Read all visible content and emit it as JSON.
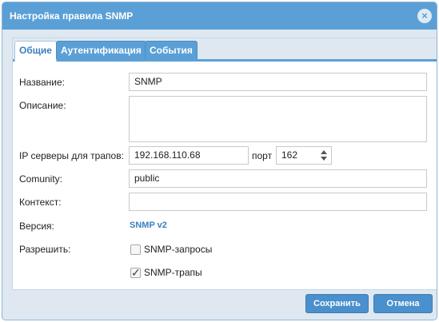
{
  "dialog": {
    "title": "Настройка правила SNMP",
    "close_icon": "×"
  },
  "tabs": [
    {
      "label": "Общие",
      "active": true
    },
    {
      "label": "Аутентификация",
      "active": false
    },
    {
      "label": "События",
      "active": false
    }
  ],
  "form": {
    "name_label": "Название:",
    "name_value": "SNMP",
    "description_label": "Описание:",
    "description_value": "",
    "ip_label": "IP серверы для трапов:",
    "ip_value": "192.168.110.68",
    "port_label": "порт",
    "port_value": "162",
    "community_label": "Comunity:",
    "community_value": "public",
    "context_label": "Контекст:",
    "context_value": "",
    "version_label": "Версия:",
    "version_value": "SNMP v2",
    "allow_label": "Разрешить:",
    "snmp_requests_label": "SNMP-запросы",
    "snmp_requests_checked": false,
    "snmp_traps_label": "SNMP-трапы",
    "snmp_traps_checked": true,
    "check_glyph": "✓"
  },
  "buttons": {
    "save": "Сохранить",
    "cancel": "Отмена"
  },
  "colors": {
    "accent": "#5aa0d6",
    "button": "#4a90cc",
    "link": "#3b7fbf"
  }
}
